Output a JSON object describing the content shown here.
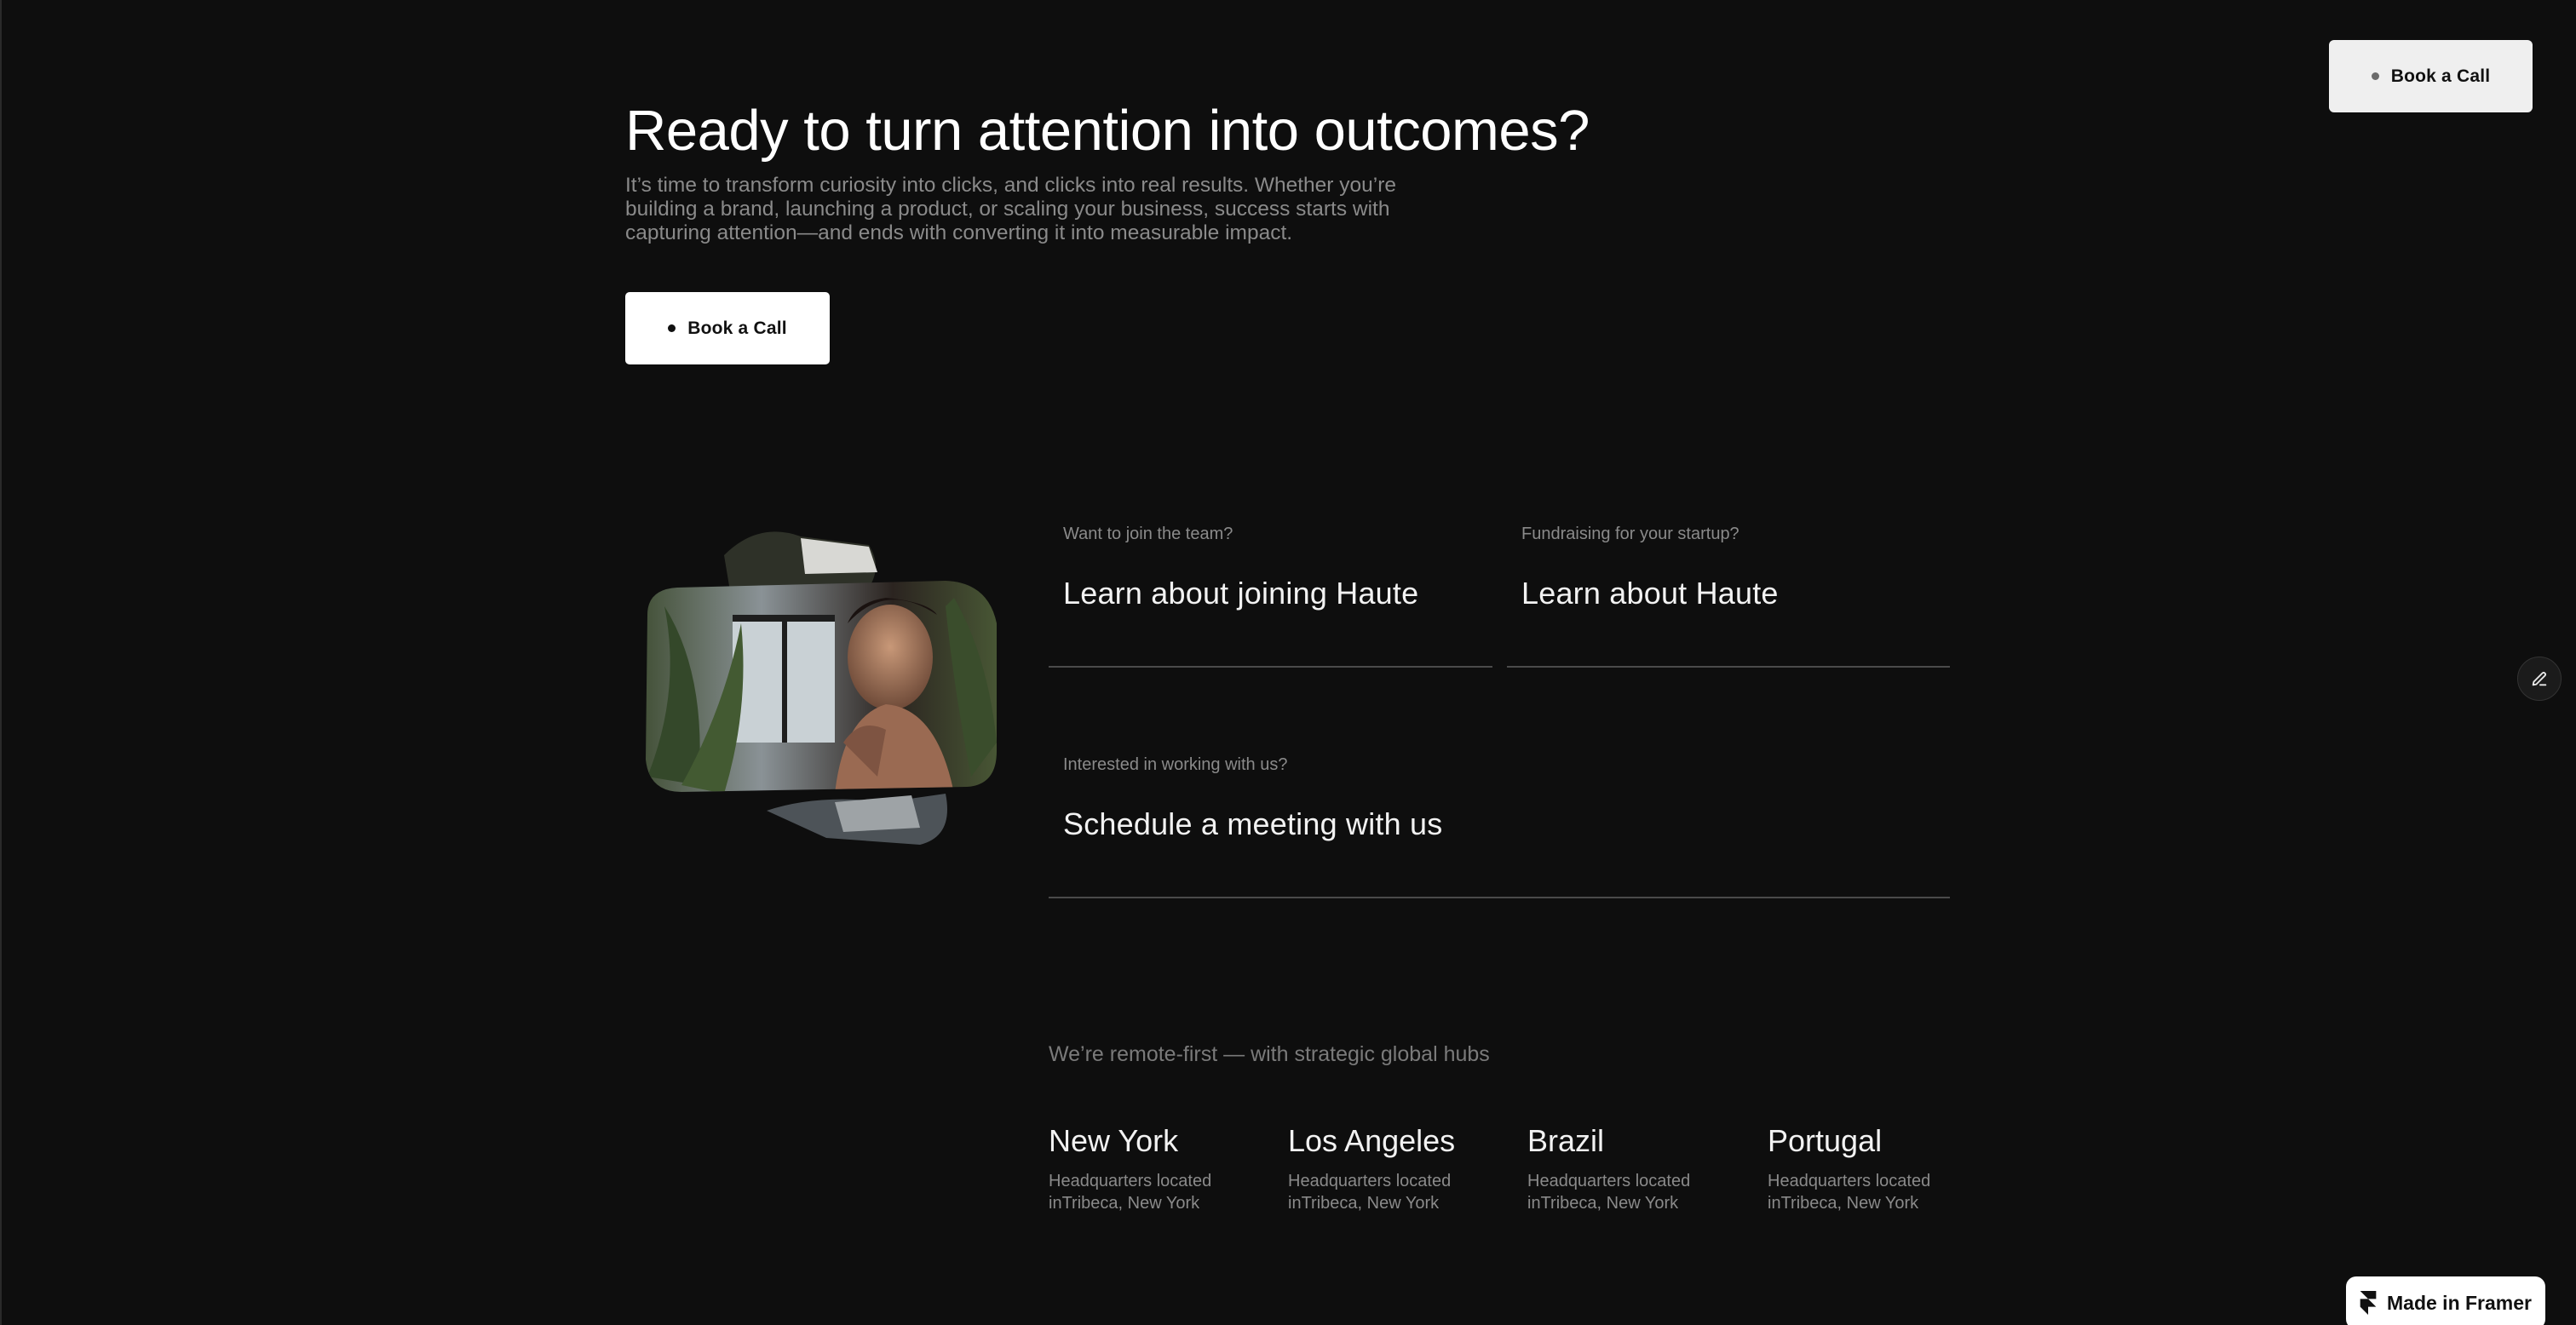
{
  "header": {
    "cta_label": "Book a Call"
  },
  "hero": {
    "title": "Ready to turn attention into outcomes?",
    "description": "It’s time to transform curiosity into clicks, and clicks into real results. Whether you’re building a brand, launching a product, or scaling your business, success starts with capturing attention—and ends with converting it into measurable impact.",
    "cta_label": "Book a Call"
  },
  "links": [
    {
      "eyebrow": "Want to join the team?",
      "title": "Learn about joining Haute"
    },
    {
      "eyebrow": "Fundraising for your startup?",
      "title": "Learn about Haute"
    },
    {
      "eyebrow": "Interested in working with us?",
      "title": "Schedule a meeting with us"
    }
  ],
  "hubs": {
    "intro": "We’re remote-first — with strategic global hubs",
    "items": [
      {
        "city": "New York",
        "address": "Headquarters located inTribeca, New York"
      },
      {
        "city": "Los Angeles",
        "address": "Headquarters located inTribeca, New York"
      },
      {
        "city": "Brazil",
        "address": "Headquarters located inTribeca, New York"
      },
      {
        "city": "Portugal",
        "address": "Headquarters located inTribeca, New York"
      }
    ]
  },
  "badge": {
    "label": "Made in Framer",
    "icon": "framer-logo-icon"
  },
  "icons": {
    "edit": "pencil-icon",
    "cta_dot": "dot-icon"
  },
  "colors": {
    "background": "#0e0e0e",
    "text_primary": "#ffffff",
    "text_muted": "#8a8a8a",
    "divider": "#4a4a4a",
    "button_bg": "#ffffff"
  }
}
